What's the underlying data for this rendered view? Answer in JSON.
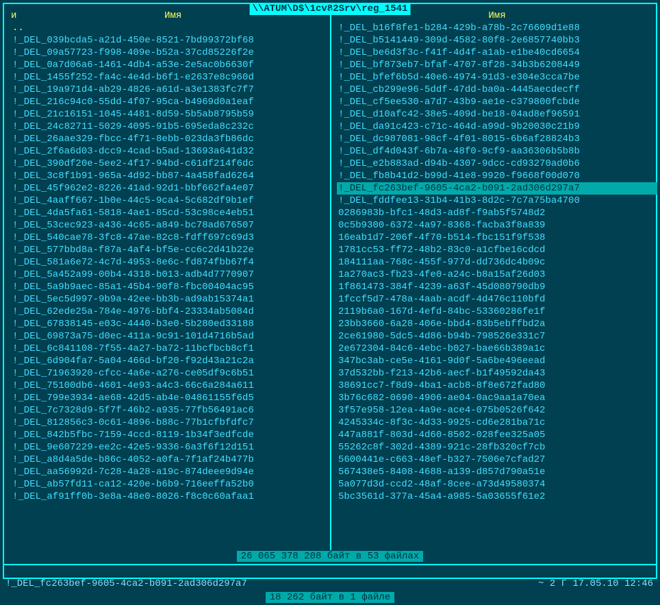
{
  "title": "\\\\ATUM\\D$\\1cv82Srv\\reg_1541",
  "header_left_prefix": "и",
  "header_name": "Имя",
  "updir": "..",
  "left_items": [
    "!_DEL_039bcda5-a21d-450e-8521-7bd99372bf68",
    "!_DEL_09a57723-f998-409e-b52a-37cd85226f2e",
    "!_DEL_0a7d06a6-1461-4db4-a53e-2e5ac0b6630f",
    "!_DEL_1455f252-fa4c-4e4d-b6f1-e2637e8c960d",
    "!_DEL_19a971d4-ab29-4826-a61d-a3e1383fc7f7",
    "!_DEL_216c94c0-55dd-4f07-95ca-b4969d0a1eaf",
    "!_DEL_21c16151-1045-4481-8d59-5b5ab8795b59",
    "!_DEL_24c82711-5029-4095-91b5-695eda8c232c",
    "!_DEL_26aae329-fbcc-4f71-8ebb-023da3fb86dc",
    "!_DEL_2f6a6d03-dcc9-4cad-b5ad-13693a641d32",
    "!_DEL_390df20e-5ee2-4f17-94bd-c61df214f6dc",
    "!_DEL_3c8f1b91-965a-4d92-bb87-4a458fad6264",
    "!_DEL_45f962e2-8226-41ad-92d1-bbf662fa4e07",
    "!_DEL_4aaff667-1b0e-44c5-9ca4-5c682df9b1ef",
    "!_DEL_4da5fa61-5818-4ae1-85cd-53c98ce4eb51",
    "!_DEL_53cec923-a436-4c65-a849-bc78ad676507",
    "!_DEL_540cae78-3fc8-47ae-82c8-fdff697c69d3",
    "!_DEL_577bbd8a-f87a-4af4-bf5e-cc6c2d41b22e",
    "!_DEL_581a6e72-4c7d-4953-8e6c-fd874fbb67f4",
    "!_DEL_5a452a99-00b4-4318-b013-adb4d7770907",
    "!_DEL_5a9b9aec-85a1-45b4-90f8-fbc00404ac95",
    "!_DEL_5ec5d997-9b9a-42ee-bb3b-ad9ab15374a1",
    "!_DEL_62ede25a-784e-4976-bbf4-23334ab5084d",
    "!_DEL_67838145-e03c-4440-b3e0-5b280ed33188",
    "!_DEL_69873a75-d0ec-411a-9c91-101d4716b5ad",
    "!_DEL_6c841108-7f55-4a27-ba72-11bcfbcb8cf1",
    "!_DEL_6d904fa7-5a04-466d-bf20-f92d43a21c2a",
    "!_DEL_71963920-cfcc-4a6e-a276-ce05df9c6b51",
    "!_DEL_75100db6-4601-4e93-a4c3-66c6a284a611",
    "!_DEL_799e3934-ae68-42d5-ab4e-04861155f6d5",
    "!_DEL_7c7328d9-5f7f-46b2-a935-77fb56491ac6",
    "!_DEL_812856c3-0c61-4896-b88c-77b1cfbfdfc7",
    "!_DEL_842b5fbc-7159-4ccd-8119-1b34f3edfcde",
    "!_DEL_9e607229-ee2c-42e5-9336-6a3f6f12d151",
    "!_DEL_a8d4a5de-b86c-4052-a0fa-7f1af24b477b",
    "!_DEL_aa56992d-7c28-4a28-a19c-874deee9d94e",
    "!_DEL_ab57fd11-ca12-420e-b6b9-716eeffa52b0",
    "!_DEL_af91ff0b-3e8a-48e0-8026-f8c0c60afaa1"
  ],
  "right_items": [
    "!_DEL_b16f8fe1-b284-429b-a78b-2c76609d1e88",
    "!_DEL_b5141449-309d-4582-80f8-2e6857740bb3",
    "!_DEL_be6d3f3c-f41f-4d4f-a1ab-e1be40cd6654",
    "!_DEL_bf873eb7-bfaf-4707-8f28-34b3b6208449",
    "!_DEL_bfef6b5d-40e6-4974-91d3-e304e3cca7be",
    "!_DEL_cb299e96-5ddf-47dd-ba0a-4445aecdecff",
    "!_DEL_cf5ee530-a7d7-43b9-ae1e-c379800fcbde",
    "!_DEL_d10afc42-38e5-409d-be18-04ad8ef96591",
    "!_DEL_da91c423-c71c-464d-a99d-9b20030c21b9",
    "!_DEL_dc987081-98cf-4f01-8015-6b6af28824b3",
    "!_DEL_df4d043f-6b7a-48f0-9cf9-aa36306b5b8b",
    "!_DEL_e2b883ad-d94b-4307-9dcc-cd93270ad0b6",
    "!_DEL_fb8b41d2-b99d-41e8-9920-f9668f00d070",
    "!_DEL_fc263bef-9605-4ca2-b091-2ad306d297a7",
    "!_DEL_fddfee13-31b4-41b3-8d2c-7c7a75ba4700",
    "0286983b-bfc1-48d3-ad8f-f9ab5f5748d2",
    "0c5b9300-6372-4a97-8368-facba3f8a839",
    "16eab1d7-206f-4f70-b514-fbc151f9f538",
    "1781cc53-ff72-48b2-83c0-a1cfbe16cdcd",
    "184111aa-768c-455f-977d-dd736dc4b09c",
    "1a270ac3-fb23-4fe0-a24c-b8a15af26d03",
    "1f861473-384f-4239-a63f-45d080790db9",
    "1fccf5d7-478a-4aab-acdf-4d476c110bfd",
    "2119b6a0-167d-4efd-84bc-53360286fe1f",
    "23bb3660-6a28-406e-bbd4-83b5ebffbd2a",
    "2ce61980-5dc5-4d86-b94b-798526e331c7",
    "2e672304-84c6-4ebc-b027-bae66b389a1c",
    "347bc3ab-ce5e-4161-9d0f-5a6be496eead",
    "37d532bb-f213-42b6-aecf-b1f49592da43",
    "38691cc7-f8d9-4ba1-acb8-8f8e672fad80",
    "3b76c682-0690-4906-ae04-0ac9aa1a70ea",
    "3f57e958-12ea-4a9e-ace4-075b0526f642",
    "4245334c-8f3c-4d33-9925-cd6e281ba71c",
    "447a881f-803d-4d60-8502-028fee325a05",
    "55262c8f-302d-4389-921c-28fb320cf7cb",
    "5600441e-c663-48ef-b327-7506e7cfad27",
    "567438e5-8408-4688-a139-d857d790a51e",
    "5a077d3d-ccd2-48af-8cee-a73d49580374",
    "5bc3561d-377a-45a4-a985-5a03655f61e2"
  ],
  "selected_count_text": "26 065 378 208 байт в 53 файлах",
  "status_filename": "!_DEL_fc263bef-9605-4ca2-b091-2ad306d297a7",
  "status_right": "~  2 Г 17.05.10 12:46",
  "bottom_status": "18 262 байт в 1 файле",
  "highlighted_index": 13
}
